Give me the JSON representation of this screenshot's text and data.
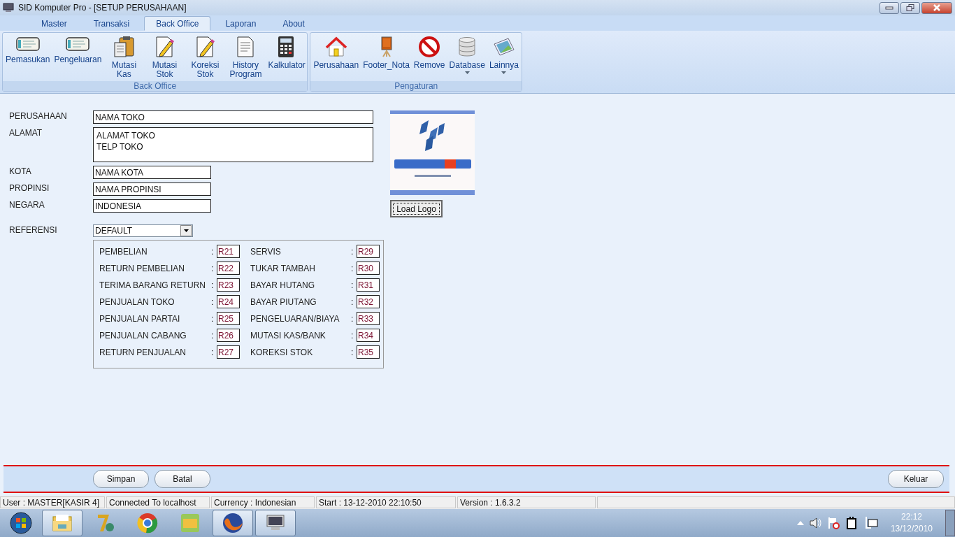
{
  "window": {
    "title": "SID Komputer Pro - [SETUP PERUSAHAAN]"
  },
  "tabs": [
    {
      "label": "Master",
      "selected": false
    },
    {
      "label": "Transaksi",
      "selected": false
    },
    {
      "label": "Back Office",
      "selected": true
    },
    {
      "label": "Laporan",
      "selected": false
    },
    {
      "label": "About",
      "selected": false
    }
  ],
  "ribbon": {
    "groups": [
      {
        "label": "Back Office",
        "items": [
          {
            "label": "Pemasukan",
            "kind": "card",
            "dropdown": false
          },
          {
            "label": "Pengeluaran",
            "kind": "card",
            "dropdown": false
          },
          {
            "label": "Mutasi Kas",
            "kind": "clipboard",
            "dropdown": false
          },
          {
            "label": "Mutasi Stok",
            "kind": "pencil",
            "dropdown": false
          },
          {
            "label": "Koreksi Stok",
            "kind": "pencil",
            "dropdown": false
          },
          {
            "label": "History Program",
            "kind": "document",
            "dropdown": false
          },
          {
            "label": "Kalkulator",
            "kind": "calculator",
            "dropdown": false
          }
        ]
      },
      {
        "label": "Pengaturan",
        "items": [
          {
            "label": "Perusahaan",
            "kind": "house",
            "dropdown": false
          },
          {
            "label": "Footer_Nota",
            "kind": "easel",
            "dropdown": false
          },
          {
            "label": "Remove",
            "kind": "forbidden",
            "dropdown": false
          },
          {
            "label": "Database",
            "kind": "database",
            "dropdown": true
          },
          {
            "label": "Lainnya",
            "kind": "tablet",
            "dropdown": true
          }
        ]
      }
    ]
  },
  "form": {
    "fields": [
      {
        "label": "PERUSAHAAN",
        "kind": "wide",
        "value": "NAMA TOKO"
      },
      {
        "label": "ALAMAT",
        "kind": "multiline",
        "value": "ALAMAT TOKO\nTELP TOKO"
      },
      {
        "label": "KOTA",
        "kind": "short",
        "value": "NAMA KOTA"
      },
      {
        "label": "PROPINSI",
        "kind": "short",
        "value": "NAMA PROPINSI"
      },
      {
        "label": "NEGARA",
        "kind": "short",
        "value": "INDONESIA"
      },
      {
        "label": "REFERENSI",
        "kind": "select",
        "value": "DEFAULT"
      }
    ],
    "references": [
      [
        {
          "label": "PEMBELIAN",
          "sep": ":",
          "code": "R21"
        },
        {
          "label": "RETURN PEMBELIAN",
          "sep": ":",
          "code": "R22"
        },
        {
          "label": "TERIMA BARANG RETURN",
          "sep": ":",
          "code": "R23"
        },
        {
          "label": "PENJUALAN TOKO",
          "sep": ":",
          "code": "R24"
        },
        {
          "label": "PENJUALAN PARTAI",
          "sep": ":",
          "code": "R25"
        },
        {
          "label": "PENJUALAN CABANG",
          "sep": ":",
          "code": "R26"
        },
        {
          "label": "RETURN PENJUALAN",
          "sep": ":",
          "code": "R27"
        }
      ],
      [
        {
          "label": "SERVIS",
          "sep": ":",
          "code": "R29"
        },
        {
          "label": "TUKAR TAMBAH",
          "sep": ":",
          "code": "R30"
        },
        {
          "label": "BAYAR HUTANG",
          "sep": ":",
          "code": "R31"
        },
        {
          "label": "BAYAR PIUTANG",
          "sep": ":",
          "code": "R32"
        },
        {
          "label": "PENGELUARAN/BIAYA",
          "sep": ":",
          "code": "R33"
        },
        {
          "label": "MUTASI KAS/BANK",
          "sep": ":",
          "code": "R34"
        },
        {
          "label": "KOREKSI STOK",
          "sep": ":",
          "code": "R35"
        }
      ]
    ],
    "logo": {
      "kind": "picture",
      "button": "Load Logo"
    }
  },
  "actions": {
    "left": [
      "Simpan",
      "Batal"
    ],
    "right": [
      "Keluar"
    ]
  },
  "status_bar": [
    "User : MASTER[KASIR 4]",
    "Connected To localhost",
    "Currency : Indonesian",
    "Start  : 13-12-2010 22:10:50",
    "Version : 1.6.3.2"
  ],
  "taskbar": {
    "apps": [
      {
        "kind": "start",
        "running": false
      },
      {
        "kind": "folder",
        "running": true
      },
      {
        "kind": "seven",
        "running": false
      },
      {
        "kind": "ball",
        "running": false
      },
      {
        "kind": "hs",
        "running": false
      },
      {
        "kind": "fox",
        "running": true
      },
      {
        "kind": "monitor",
        "running": true
      }
    ],
    "time": "22:12",
    "date": "13/12/2010"
  }
}
